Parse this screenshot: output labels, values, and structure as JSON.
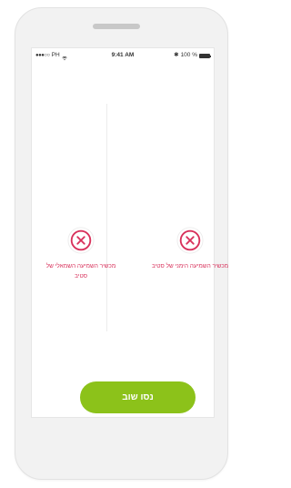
{
  "status_bar": {
    "signal_dots": "●●●○○",
    "carrier": "PH",
    "time": "9:41 AM",
    "battery": "100 %"
  },
  "devices": [
    {
      "label": "מכשיר השמיעה השמאלי של סטיב",
      "status": "error"
    },
    {
      "label": "מכשיר השמיעה הימני של סטיב",
      "status": "error"
    }
  ],
  "retry_button": {
    "label": "נסו שוב"
  },
  "colors": {
    "error": "#d8315b",
    "accent": "#8cc21a",
    "screen_bg": "#ffffff",
    "phone_bg": "#f2f2f2"
  },
  "icons": {
    "error": "close-circle-icon",
    "wifi": "wifi-icon",
    "bluetooth": "bluetooth-icon",
    "battery": "battery-icon"
  }
}
